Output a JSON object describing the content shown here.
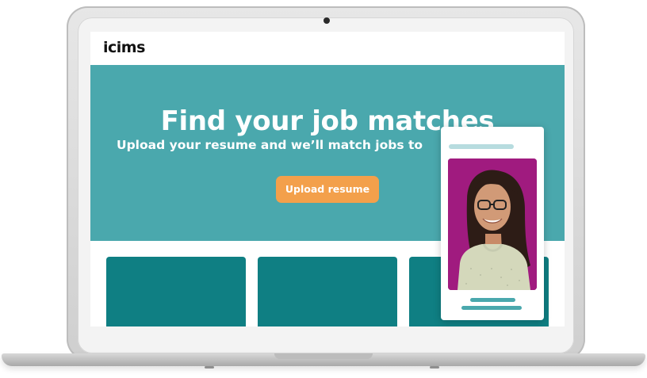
{
  "site": {
    "logo_text": "icims"
  },
  "hero": {
    "title": "Find your job matches",
    "subtitle": "Upload your resume and we’ll match jobs to",
    "upload_button_label": "Upload resume"
  },
  "job_cards_count": 3,
  "colors": {
    "hero_bg": "#4aa8ad",
    "upload_button": "#f3a04b",
    "job_card": "#0f7f83",
    "profile_bg": "#a01b7f"
  },
  "icons": {
    "camera": "camera-icon",
    "profile": "person-photo"
  }
}
